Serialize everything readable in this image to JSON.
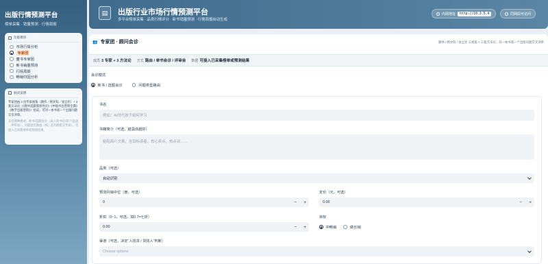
{
  "sidebar": {
    "title": "出版行情预测平台",
    "subtitle": "榜单采集 · 销量预测 · 行情周报",
    "nav_header": "功能模块",
    "items": [
      {
        "label": "市场行情分析",
        "active": false
      },
      {
        "label": "专家团",
        "active": true
      },
      {
        "label": "童书专家团",
        "active": false
      },
      {
        "label": "新书销量预测",
        "active": false
      },
      {
        "label": "行情周报",
        "active": false
      },
      {
        "label": "畅销归因分析",
        "active": false
      }
    ],
    "desc_header": "顾问说明",
    "desc_main": "专家团由 3 位专家视角（路伟／韩文科／张立宪）+ 3 套方法论（《图书选题策划导论》《中国书业营销全典》《数字出版营销》）组成，可对一本书或一个出版问题交叉评审。",
    "desc_muted": "支持两种模式：新书/选题会诊（录入的书名/简介/品类→评审会），问题类型路由（按 | 选问题提交专家），可接入已采集榜单或预测结果。"
  },
  "header": {
    "title": "出版行业市场行情预测平台",
    "subtitle": "多平台榜单采集 · 品类行情评分 · 新书销量预测 · 行情周报自动生成",
    "address_label": "内网地址",
    "address_value": "http://10.3.5.4",
    "team_button": "同网段可访问"
  },
  "section": {
    "title": "专家团 · 顾问会诊",
    "right_note": "路伟 / 韩文科 / 张立宪 三视角 × 三套方法论，对一本书或一个出版问题交叉评审"
  },
  "infobar": {
    "members_label": "成员",
    "members_value": "3 专家 + 3 方法论",
    "mode_label": "方式",
    "mode_value": "路由 / 单书会诊 / 评审会",
    "data_label": "数据",
    "data_value": "可接入已采集榜单或预测结果"
  },
  "consult_mode": {
    "label": "会诊模式",
    "options": [
      {
        "label": "新书 / 选题会诊",
        "selected": true
      },
      {
        "label": "问题类型路由",
        "selected": false
      }
    ]
  },
  "form": {
    "book_name_label": "书名",
    "book_name_placeholder": "例如：AI时代孩子如何学习",
    "intro_label": "书籍简介（可选，越具体越好）",
    "intro_placeholder": "粘贴简介文案，含目标读者、核心卖点、热点词……",
    "category_label": "品类（可选）",
    "category_value": "自动识别",
    "monthly_sales_label": "预测月销中位（册，可选）",
    "monthly_sales_value": "0",
    "price_label": "定价（元，可选）",
    "price_value": "0.00",
    "discount_label": "折扣（0~1，可选，如0.7=七折）",
    "discount_value": "0.00",
    "target_label": "目标",
    "target_options": [
      {
        "label": "冲畅销",
        "selected": true
      },
      {
        "label": "做长销",
        "selected": false
      }
    ],
    "channel_label": "渠道（可选，决定“人找货 / 货找人”判断）",
    "channel_placeholder": "Choose options",
    "minus": "−",
    "plus": "+"
  }
}
